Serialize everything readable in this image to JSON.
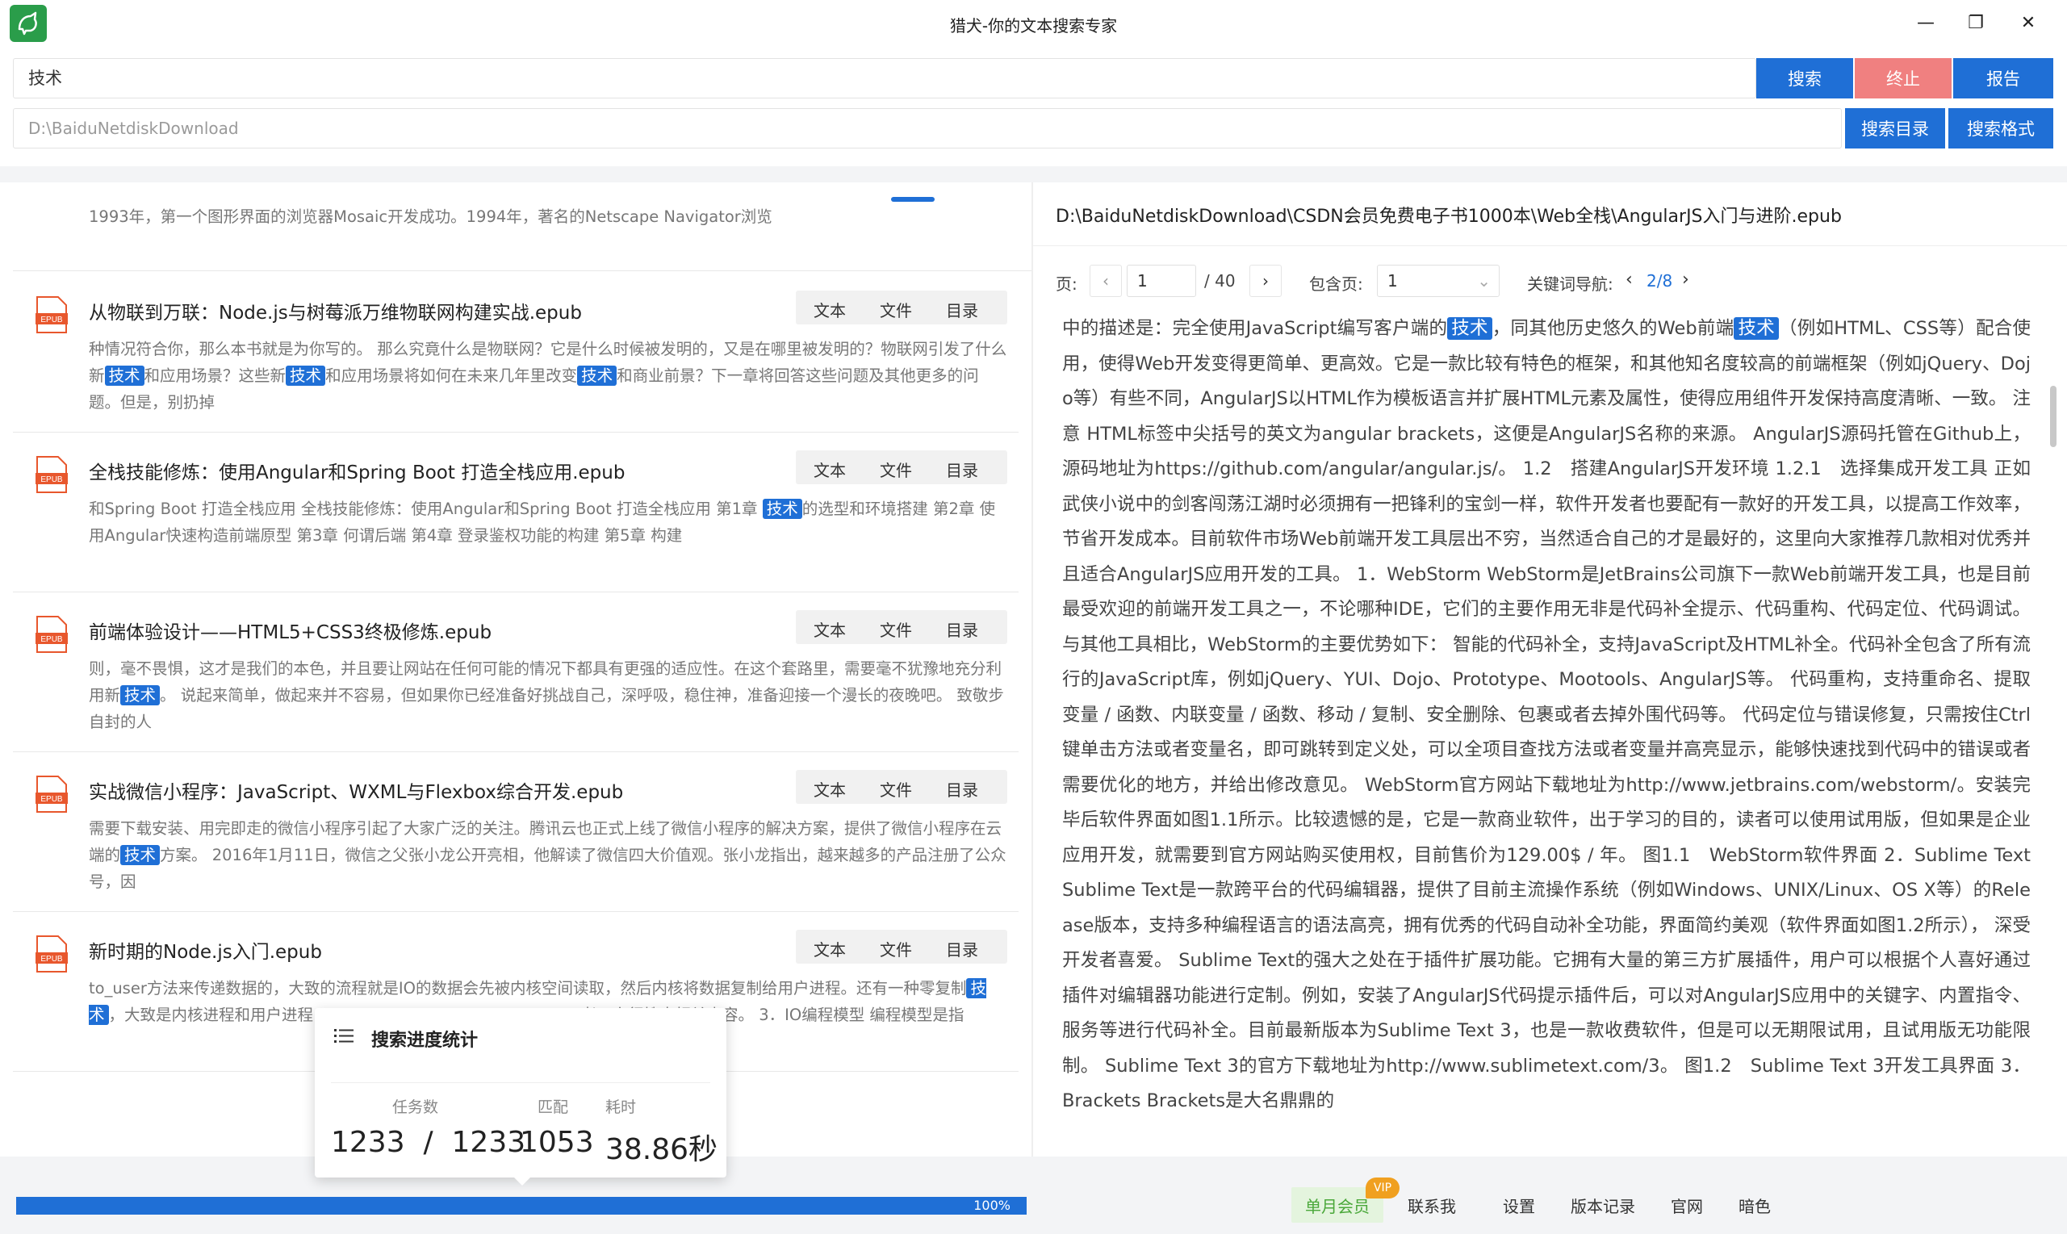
{
  "window": {
    "title": "猎犬-你的文本搜索专家",
    "minimize": "—",
    "maximize": "❐",
    "close": "✕"
  },
  "toolbar": {
    "query": "技术",
    "search_label": "搜索",
    "stop_label": "终止",
    "report_label": "报告",
    "directory": "D:\\BaiduNetdiskDownload",
    "search_dir_label": "搜索目录",
    "search_format_label": "搜索格式"
  },
  "results": {
    "partial_snippet": "1993年，第一个图形界面的浏览器Mosaic开发成功。1994年，著名的Netscape Navigator浏览",
    "action_text": "文本",
    "action_file": "文件",
    "action_toc": "目录",
    "icon_label": "EPUB",
    "items": [
      {
        "title": "从物联到万联：Node.js与树莓派万维物联网构建实战.epub",
        "s1": "种情况符合你，那么本书就是为你写的。 那么究竟什么是物联网？它是什么时候被发明的，又是在哪里被发明的？物联网引发了什么新",
        "h1": "技术",
        "s2": "和应用场景？这些新",
        "h2": "技术",
        "s3": "和应用场景将如何在未来几年里改变",
        "h3": "技术",
        "s4": "和商业前景？下一章将回答这些问题及其他更多的问题。但是，别扔掉"
      },
      {
        "title": "全栈技能修炼：使用Angular和Spring Boot 打造全栈应用.epub",
        "s1": "和Spring Boot 打造全栈应用 全栈技能修炼：使用Angular和Spring Boot 打造全栈应用 第1章 ",
        "h1": "技术",
        "s2": "的选型和环境搭建 第2章 使用Angular快速构造前端原型 第3章 何谓后端 第4章 登录鉴权功能的构建 第5章 构建"
      },
      {
        "title": "前端体验设计——HTML5+CSS3终极修炼.epub",
        "s1": "则，毫不畏惧，这才是我们的本色，并且要让网站在任何可能的情况下都具有更强的适应性。在这个套路里，需要毫不犹豫地充分利用新",
        "h1": "技术",
        "s2": "。 说起来简单，做起来并不容易，但如果你已经准备好挑战自己，深呼吸，稳住神，准备迎接一个漫长的夜晚吧。 致敬步自封的人"
      },
      {
        "title": "实战微信小程序：JavaScript、WXML与Flexbox综合开发.epub",
        "s1": "需要下载安装、用完即走的微信小程序引起了大家广泛的关注。腾讯云也正式上线了微信小程序的解决方案，提供了微信小程序在云端的",
        "h1": "技术",
        "s2": "方案。 2016年1月11日，微信之父张小龙公开亮相，他解读了微信四大价值观。张小龙指出，越来越多的产品注册了公众号，因"
      },
      {
        "title": "新时期的Node.js入门.epub",
        "s1": "to_user方法来传递数据的，大致的流程就是IO的数据会先被内核空间读取，然后内核将数据复制给用户进程。还有一种零复制",
        "h1": "技术",
        "s2": "，大致是内核进程和用户进程……………………………………………者可自行搜索相关内容。 3．IO编程模型 编程模型是指"
      }
    ]
  },
  "stats_popup": {
    "title": "搜索进度统计",
    "tasks_label": "任务数",
    "match_label": "匹配",
    "time_label": "耗时",
    "tasks_value": "1233  /  1233",
    "match_value": "1053",
    "time_value": "38.86秒"
  },
  "viewer": {
    "file_path": "D:\\BaiduNetdiskDownload\\CSDN会员免费电子书1000本\\Web全栈\\AngularJS入门与进阶.epub",
    "page_label": "页:",
    "page_value": "1",
    "page_total": "/ 40",
    "contains_label": "包含页:",
    "contains_value": "1",
    "kw_nav_label": "关键词导航:",
    "kw_nav_value": "2/8",
    "content_a": "中的描述是：完全使用JavaScript编写客户端的",
    "content_hl1": "技术",
    "content_b": "，同其他历史悠久的Web前端",
    "content_hl2": "技术",
    "content_c": "（例如HTML、CSS等）配合使用，使得Web开发变得更简单、更高效。它是一款比较有特色的框架，和其他知名度较高的前端框架（例如jQuery、Dojo等）有些不同，AngularJS以HTML作为模板语言并扩展HTML元素及属性，使得应用组件开发保持高度清晰、一致。 注意 HTML标签中尖括号的英文为angular brackets，这便是AngularJS名称的来源。 AngularJS源码托管在Github上，源码地址为https://github.com/angular/angular.js/。 1.2　搭建AngularJS开发环境 1.2.1　选择集成开发工具 正如武侠小说中的剑客闯荡江湖时必须拥有一把锋利的宝剑一样，软件开发者也要配有一款好的开发工具，以提高工作效率，节省开发成本。目前软件市场Web前端开发工具层出不穷，当然适合自己的才是最好的，这里向大家推荐几款相对优秀并且适合AngularJS应用开发的工具。 1．WebStorm WebStorm是JetBrains公司旗下一款Web前端开发工具，也是目前最受欢迎的前端开发工具之一，不论哪种IDE，它们的主要作用无非是代码补全提示、代码重构、代码定位、代码调试。与其他工具相比，WebStorm的主要优势如下： 智能的代码补全，支持JavaScript及HTML补全。代码补全包含了所有流行的JavaScript库，例如jQuery、YUI、Dojo、Prototype、Mootools、AngularJS等。 代码重构，支持重命名、提取变量 / 函数、内联变量 / 函数、移动 / 复制、安全删除、包裹或者去掉外围代码等。 代码定位与错误修复，只需按住Ctrl键单击方法或者变量名，即可跳转到定义处，可以全项目查找方法或者变量并高亮显示，能够快速找到代码中的错误或者需要优化的地方，并给出修改意见。 WebStorm官方网站下载地址为http://www.jetbrains.com/webstorm/。安装完毕后软件界面如图1.1所示。比较遗憾的是，它是一款商业软件，出于学习的目的，读者可以使用试用版，但如果是企业应用开发，就需要到官方网站购买使用权，目前售价为129.00$ / 年。 图1.1　WebStorm软件界面 2．Sublime Text Sublime Text是一款跨平台的代码编辑器，提供了目前主流操作系统（例如Windows、UNIX/Linux、OS X等）的Release版本，支持多种编程语言的语法高亮，拥有优秀的代码自动补全功能，界面简约美观（软件界面如图1.2所示）， 深受开发者喜爱。 Sublime Text的强大之处在于插件扩展功能。它拥有大量的第三方扩展插件，用户可以根据个人喜好通过插件对编辑器功能进行定制。例如，安装了AngularJS代码提示插件后，可以对AngularJS应用中的关键字、内置指令、服务等进行代码补全。目前最新版本为Sublime Text 3，也是一款收费软件，但是可以无期限试用，且试用版无功能限制。 Sublime Text 3的官方下载地址为http://www.sublimetext.com/3。 图1.2　Sublime Text 3开发工具界面 3．Brackets Brackets是大名鼎鼎的"
  },
  "progress": {
    "percent": 100,
    "label": "100%"
  },
  "footer": {
    "member_label": "单月会员",
    "vip_badge": "VIP",
    "contact": "联系我",
    "settings": "设置",
    "changelog": "版本记录",
    "website": "官网",
    "dark": "暗色"
  },
  "colors": {
    "accent": "#1f6fd6",
    "stop": "#f08080",
    "member_bg": "#e4f4de",
    "vip": "#f0a020"
  }
}
